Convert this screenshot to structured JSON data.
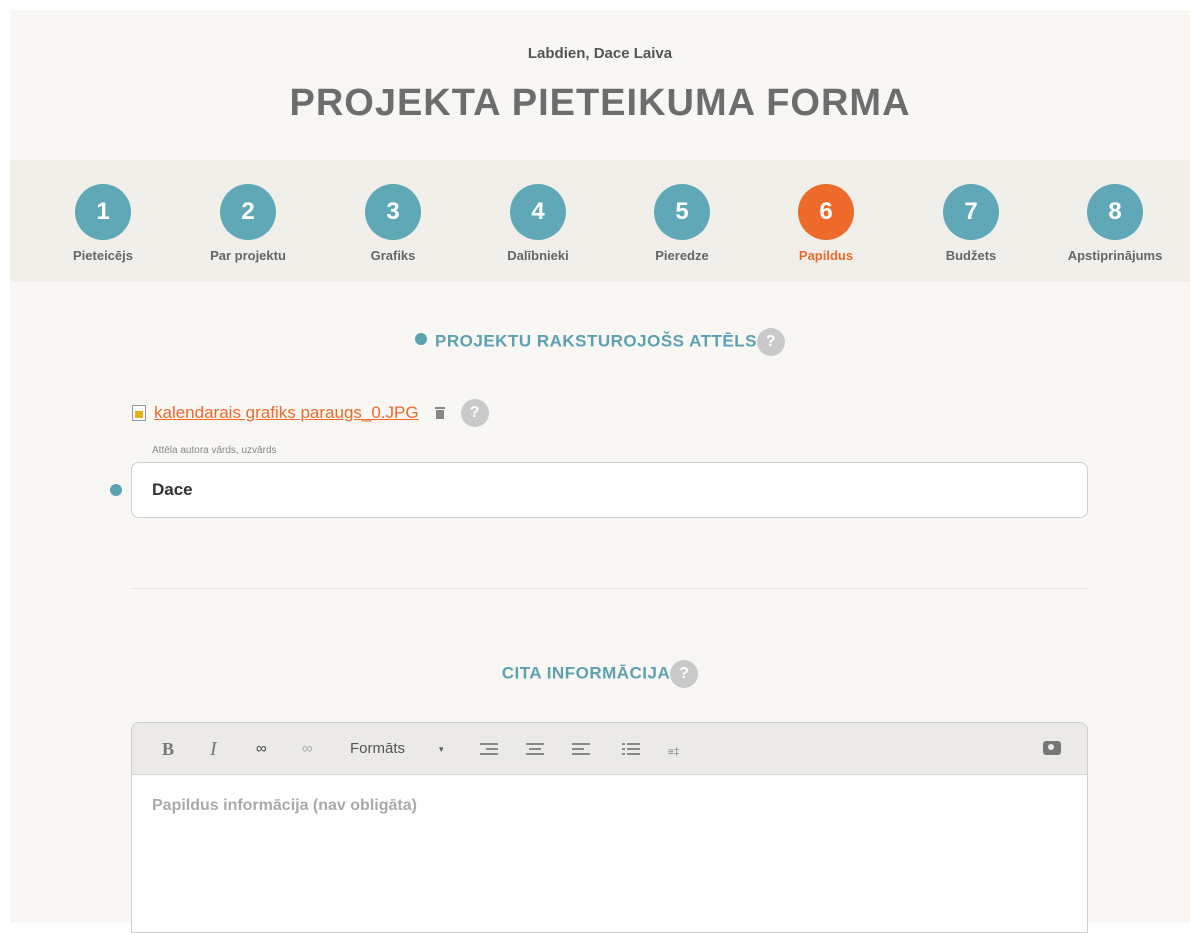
{
  "header": {
    "greeting": "Labdien, Dace Laiva",
    "title": "PROJEKTA PIETEIKUMA FORMA"
  },
  "steps": [
    {
      "number": "1",
      "label": "Pieteicējs"
    },
    {
      "number": "2",
      "label": "Par projektu"
    },
    {
      "number": "3",
      "label": "Grafiks"
    },
    {
      "number": "4",
      "label": "Dalībnieki"
    },
    {
      "number": "5",
      "label": "Pieredze"
    },
    {
      "number": "6",
      "label": "Papildus",
      "active": true
    },
    {
      "number": "7",
      "label": "Budžets"
    },
    {
      "number": "8",
      "label": "Apstiprinājums"
    }
  ],
  "image_section": {
    "title": "PROJEKTU RAKSTUROJOŠS ATTĒLS",
    "help": "?",
    "file_name": "kalendarais grafiks paraugs_0.JPG",
    "author_label": "Attēla autora vārds, uzvārds",
    "author_value": "Dace"
  },
  "other_section": {
    "title": "CITA INFORMĀCIJA",
    "help": "?",
    "toolbar": {
      "bold": "B",
      "italic": "I",
      "format_label": "Formāts",
      "caret": "▾"
    },
    "placeholder": "Papildus informācija (nav obligāta)"
  },
  "colors": {
    "accent": "#5aa1b2",
    "active": "#ee6a2a",
    "step": "#60a8b8"
  },
  "icons": [
    "file-image-icon",
    "trash-icon",
    "help-icon",
    "link-icon",
    "unlink-icon",
    "align-right-icon",
    "align-center-icon",
    "align-left-icon",
    "list-icon",
    "clear-format-icon",
    "camera-icon"
  ]
}
